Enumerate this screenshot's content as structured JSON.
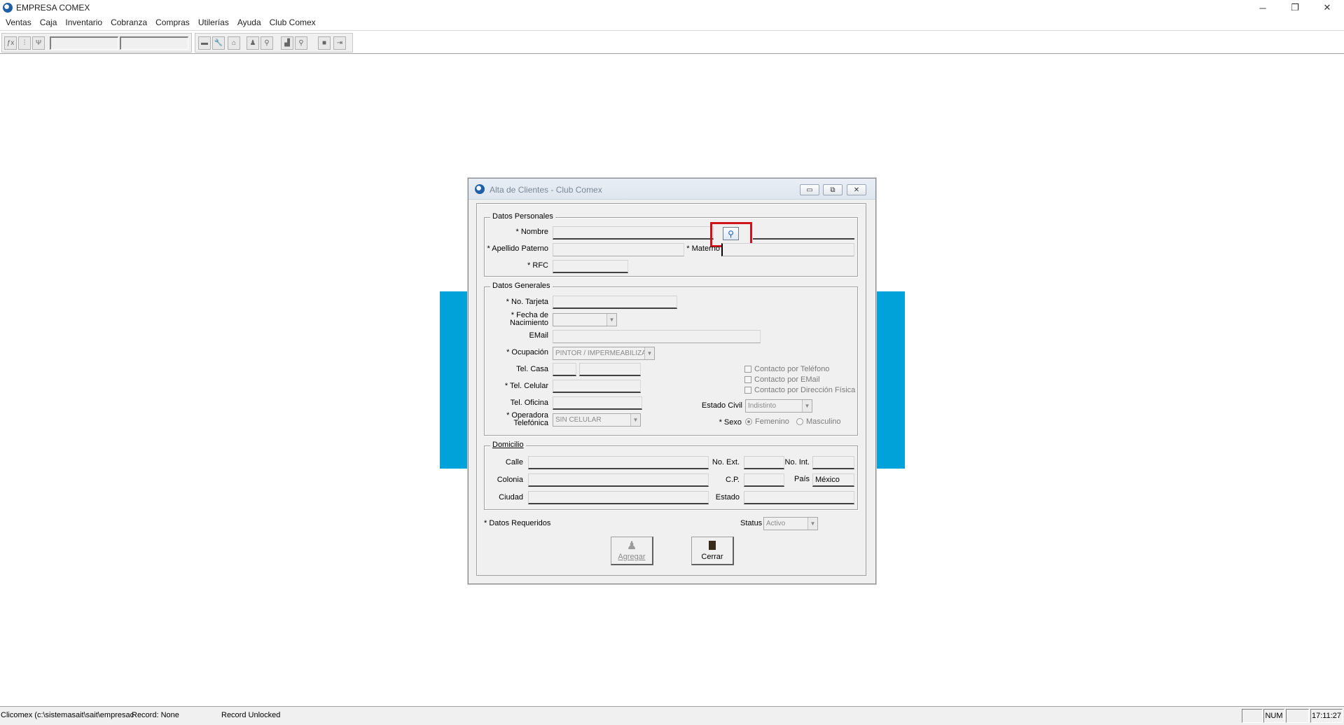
{
  "window": {
    "title": "EMPRESA COMEX",
    "minimize_glyph": "─",
    "restore_glyph": "❐",
    "close_glyph": "✕"
  },
  "menu": [
    "Ventas",
    "Caja",
    "Inventario",
    "Cobranza",
    "Compras",
    "Utilerías",
    "Ayuda",
    "Club Comex"
  ],
  "toolbar": {
    "left_icons": [
      "function-icon",
      "filter-icon",
      "filter-all-icon"
    ],
    "right_icons": [
      "first-record-icon",
      "find-icon",
      "home-icon",
      "user-icon",
      "search-icon",
      "chart-icon",
      "zoom-icon",
      "stop-icon",
      "exit-icon"
    ]
  },
  "dialog": {
    "title": "Alta de Clientes - Club Comex",
    "datos_personales": {
      "title": "Datos Personales",
      "nombre_label": "* Nombre",
      "apellido_paterno_label": "* Apellido Paterno",
      "materno_label": "* Materno",
      "rfc_label": "* RFC",
      "nombre_value": "",
      "apellido_paterno_value": "",
      "materno_value": "",
      "rfc_value": ""
    },
    "datos_generales": {
      "title": "Datos Generales",
      "no_tarjeta_label": "* No. Tarjeta",
      "fecha_label_1": "* Fecha de",
      "fecha_label_2": "Nacimiento",
      "email_label": "EMail",
      "ocupacion_label": "* Ocupación",
      "ocupacion_value": "PINTOR / IMPERMEABILIZA",
      "tel_casa_label": "Tel. Casa",
      "tel_celular_label": "* Tel. Celular",
      "tel_oficina_label": "Tel. Oficina",
      "operadora_label_1": "* Operadora",
      "operadora_label_2": "Telefónica",
      "operadora_value": "SIN CELULAR",
      "contacto_telefono": "Contacto por Teléfono",
      "contacto_email": "Contacto por EMail",
      "contacto_direccion": "Contacto por Dirección Física",
      "estado_civil_label": "Estado Civil",
      "estado_civil_value": "Indistinto",
      "sexo_label": "* Sexo",
      "sexo_femenino": "Femenino",
      "sexo_masculino": "Masculino"
    },
    "domicilio": {
      "title": "Domicilio",
      "calle_label": "Calle",
      "no_ext_label": "No. Ext.",
      "no_int_label": "No. Int.",
      "colonia_label": "Colonia",
      "cp_label": "C.P.",
      "pais_label": "País",
      "pais_value": "México",
      "ciudad_label": "Ciudad",
      "estado_label": "Estado"
    },
    "requeridos_label": "* Datos Requeridos",
    "status_label": "Status",
    "status_value": "Activo",
    "agregar_label": "Agregar",
    "cerrar_label": "Cerrar"
  },
  "statusbar": {
    "path": "Clicomex (c:\\sistemasait\\sait\\empresac",
    "record": "Record: None",
    "lock": "Record Unlocked",
    "num": "NUM",
    "time": "17:11:27"
  },
  "colors": {
    "blue_panel": "#00a3d9",
    "highlight_border": "#d0121b"
  }
}
